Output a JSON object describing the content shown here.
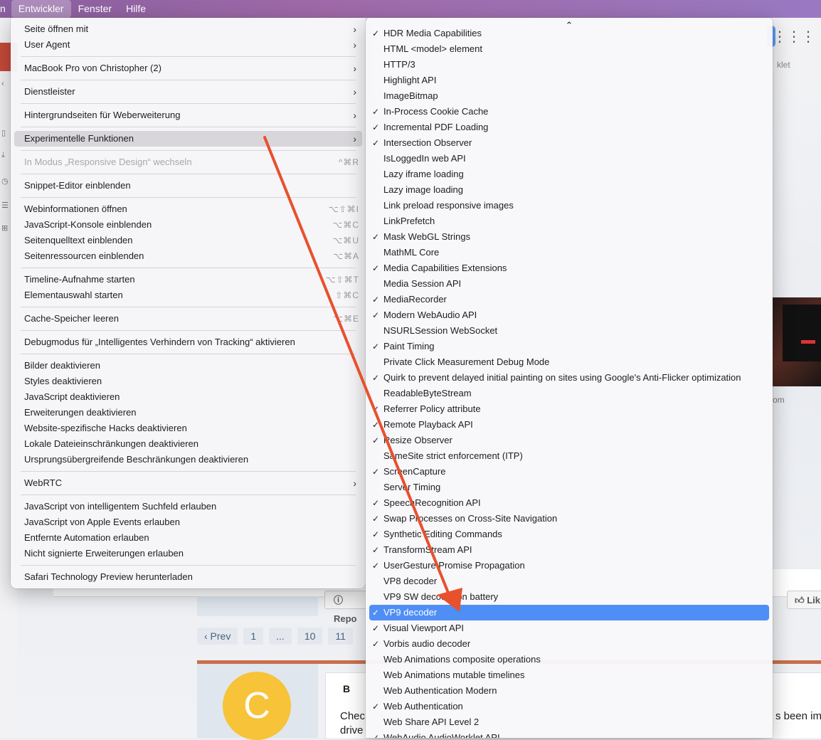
{
  "menubar": {
    "items": [
      "n",
      "Entwickler",
      "Fenster",
      "Hilfe"
    ]
  },
  "background": {
    "tab_text": "klet",
    "domain_text": "om",
    "report_label": "Repo",
    "like_label": "Lik",
    "pager": [
      "‹ Prev",
      "1",
      "...",
      "10",
      "11"
    ],
    "avatar_letter": "C",
    "post_bold": "B",
    "post_line1": "Chec",
    "post_line2": "drive",
    "post_tail": "s been im"
  },
  "left_menu": {
    "groups": [
      [
        {
          "label": "Seite öffnen mit",
          "chevron": true
        },
        {
          "label": "User Agent",
          "chevron": true
        }
      ],
      [
        {
          "label": "MacBook Pro von Christopher (2)",
          "chevron": true
        }
      ],
      [
        {
          "label": "Dienstleister",
          "chevron": true
        }
      ],
      [
        {
          "label": "Hintergrundseiten für Weberweiterung",
          "chevron": true
        }
      ],
      [
        {
          "label": "Experimentelle Funktionen",
          "chevron": true,
          "highlighted": true
        }
      ],
      [
        {
          "label": "In Modus „Responsive Design“ wechseln",
          "shortcut": "^⌘R",
          "disabled": true
        }
      ],
      [
        {
          "label": "Snippet-Editor einblenden"
        }
      ],
      [
        {
          "label": "Webinformationen öffnen",
          "shortcut": "⌥⇧⌘I"
        },
        {
          "label": "JavaScript-Konsole einblenden",
          "shortcut": "⌥⌘C"
        },
        {
          "label": "Seitenquelltext einblenden",
          "shortcut": "⌥⌘U"
        },
        {
          "label": "Seitenressourcen einblenden",
          "shortcut": "⌥⌘A"
        }
      ],
      [
        {
          "label": "Timeline-Aufnahme starten",
          "shortcut": "⌥⇧⌘T"
        },
        {
          "label": "Elementauswahl starten",
          "shortcut": "⇧⌘C"
        }
      ],
      [
        {
          "label": "Cache-Speicher leeren",
          "shortcut": "⌥⌘E"
        }
      ],
      [
        {
          "label": "Debugmodus für „Intelligentes Verhindern von Tracking“ aktivieren"
        }
      ],
      [
        {
          "label": "Bilder deaktivieren"
        },
        {
          "label": "Styles deaktivieren"
        },
        {
          "label": "JavaScript deaktivieren"
        },
        {
          "label": "Erweiterungen deaktivieren"
        },
        {
          "label": "Website-spezifische Hacks deaktivieren"
        },
        {
          "label": "Lokale Dateieinschränkungen deaktivieren"
        },
        {
          "label": "Ursprungsübergreifende Beschränkungen deaktivieren"
        }
      ],
      [
        {
          "label": "WebRTC",
          "chevron": true
        }
      ],
      [
        {
          "label": "JavaScript von intelligentem Suchfeld erlauben"
        },
        {
          "label": "JavaScript von Apple Events erlauben"
        },
        {
          "label": "Entfernte Automation erlauben"
        },
        {
          "label": "Nicht signierte Erweiterungen erlauben"
        }
      ],
      [
        {
          "label": "Safari Technology Preview herunterladen"
        }
      ]
    ]
  },
  "right_menu": {
    "scroll_indicator": "⌃",
    "items": [
      {
        "label": "HDR Media Capabilities",
        "checked": true
      },
      {
        "label": "HTML <model> element",
        "checked": false
      },
      {
        "label": "HTTP/3",
        "checked": false
      },
      {
        "label": "Highlight API",
        "checked": false
      },
      {
        "label": "ImageBitmap",
        "checked": false
      },
      {
        "label": "In-Process Cookie Cache",
        "checked": true
      },
      {
        "label": "Incremental PDF Loading",
        "checked": true
      },
      {
        "label": "Intersection Observer",
        "checked": true
      },
      {
        "label": "IsLoggedIn web API",
        "checked": false
      },
      {
        "label": "Lazy iframe loading",
        "checked": false
      },
      {
        "label": "Lazy image loading",
        "checked": false
      },
      {
        "label": "Link preload responsive images",
        "checked": false
      },
      {
        "label": "LinkPrefetch",
        "checked": false
      },
      {
        "label": "Mask WebGL Strings",
        "checked": true
      },
      {
        "label": "MathML Core",
        "checked": false
      },
      {
        "label": "Media Capabilities Extensions",
        "checked": true
      },
      {
        "label": "Media Session API",
        "checked": false
      },
      {
        "label": "MediaRecorder",
        "checked": true
      },
      {
        "label": "Modern WebAudio API",
        "checked": true
      },
      {
        "label": "NSURLSession WebSocket",
        "checked": false
      },
      {
        "label": "Paint Timing",
        "checked": true
      },
      {
        "label": "Private Click Measurement Debug Mode",
        "checked": false
      },
      {
        "label": "Quirk to prevent delayed initial painting on sites using Google's Anti-Flicker optimization",
        "checked": true
      },
      {
        "label": "ReadableByteStream",
        "checked": false
      },
      {
        "label": "Referrer Policy attribute",
        "checked": true
      },
      {
        "label": "Remote Playback API",
        "checked": true
      },
      {
        "label": "Resize Observer",
        "checked": true
      },
      {
        "label": "SameSite strict enforcement (ITP)",
        "checked": false
      },
      {
        "label": "ScreenCapture",
        "checked": true
      },
      {
        "label": "Server Timing",
        "checked": false
      },
      {
        "label": "SpeechRecognition API",
        "checked": true
      },
      {
        "label": "Swap Processes on Cross-Site Navigation",
        "checked": true
      },
      {
        "label": "Synthetic Editing Commands",
        "checked": true
      },
      {
        "label": "TransformStream API",
        "checked": true
      },
      {
        "label": "UserGesture Promise Propagation",
        "checked": true
      },
      {
        "label": "VP8 decoder",
        "checked": false
      },
      {
        "label": "VP9 SW decoder on battery",
        "checked": false
      },
      {
        "label": "VP9 decoder",
        "checked": true,
        "selected": true
      },
      {
        "label": "Visual Viewport API",
        "checked": true
      },
      {
        "label": "Vorbis audio decoder",
        "checked": true
      },
      {
        "label": "Web Animations composite operations",
        "checked": false
      },
      {
        "label": "Web Animations mutable timelines",
        "checked": false
      },
      {
        "label": "Web Authentication Modern",
        "checked": false
      },
      {
        "label": "Web Authentication",
        "checked": true
      },
      {
        "label": "Web Share API Level 2",
        "checked": false
      },
      {
        "label": "WebAudio AudioWorklet API",
        "checked": true
      }
    ]
  },
  "colors": {
    "selection": "#4f8ef5",
    "annotation_arrow": "#e8502e"
  }
}
